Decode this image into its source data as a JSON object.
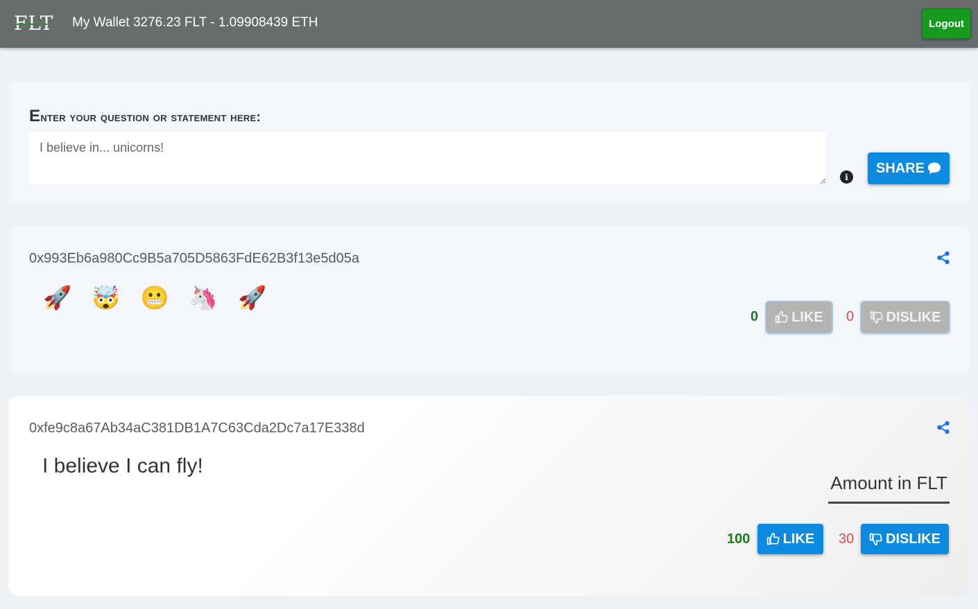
{
  "header": {
    "logo_text": "FLT",
    "wallet_text": "My Wallet 3276.23 FLT - 1.09908439 ETH",
    "logout_label": "Logout"
  },
  "question": {
    "label_first": "E",
    "label_rest": "nter your question or statement here:",
    "placeholder": "I believe in... unicorns!",
    "share_label": "SHARE",
    "info_icon": "info-icon"
  },
  "posts": [
    {
      "address": "0x993Eb6a980Cc9B5a705D5863FdE62B3f13e5d05a",
      "content": "🚀 🤯 😬 🦄 🚀",
      "likes": "0",
      "dislikes": "0",
      "like_label": "LIKE",
      "dislike_label": "DISLIKE",
      "state": "disabled"
    },
    {
      "address": "0xfe9c8a67Ab34aC381DB1A7C63Cda2Dc7a17E338d",
      "content": "I believe I can fly!",
      "amount_placeholder": "Amount in FLT",
      "likes": "100",
      "dislikes": "30",
      "like_label": "LIKE",
      "dislike_label": "DISLIKE",
      "state": "enabled"
    }
  ],
  "colors": {
    "header_bg": "#686c6d",
    "logout_green": "#169a1f",
    "button_blue": "#0c8ae0",
    "like_count": "#1f7a1f",
    "dislike_count": "#e04a4a"
  }
}
